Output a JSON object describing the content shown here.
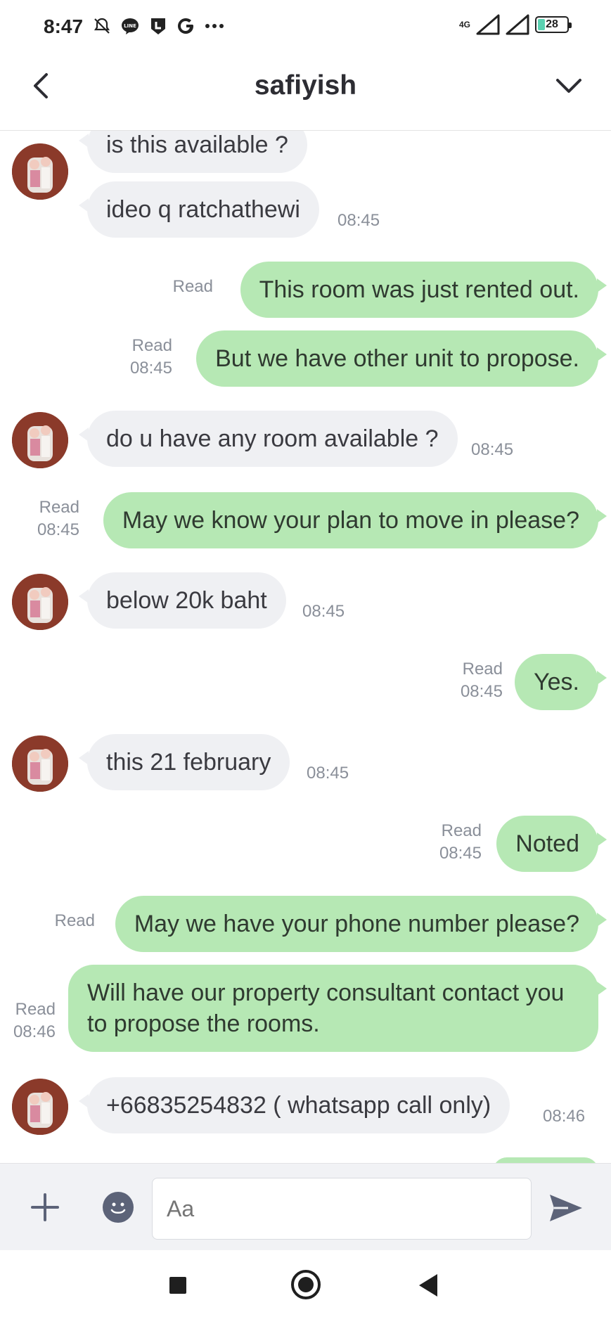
{
  "status_bar": {
    "time": "8:47",
    "icons": [
      "mute-icon",
      "line-icon",
      "l-icon",
      "g-icon",
      "more-dots-icon"
    ],
    "network": "4G",
    "battery": "28"
  },
  "header": {
    "title": "safiyish"
  },
  "messages": [
    {
      "side": "in",
      "text": "is this available ?",
      "time": ""
    },
    {
      "side": "in",
      "text": "ideo q ratchathewi",
      "time": "08:45"
    },
    {
      "side": "out",
      "text": "This room was just rented out.",
      "read": "Read",
      "time": ""
    },
    {
      "side": "out",
      "text": "But we have other unit to propose.",
      "read": "Read",
      "time": "08:45"
    },
    {
      "side": "in",
      "text": "do u have any room available ?",
      "time": "08:45"
    },
    {
      "side": "out",
      "text": "May we know your plan to move in please?",
      "read": "Read",
      "time": "08:45"
    },
    {
      "side": "in",
      "text": "below 20k baht",
      "time": "08:45"
    },
    {
      "side": "out",
      "text": "Yes.",
      "read": "Read",
      "time": "08:45"
    },
    {
      "side": "in",
      "text": "this 21 february",
      "time": "08:45"
    },
    {
      "side": "out",
      "text": "Noted",
      "read": "Read",
      "time": "08:45"
    },
    {
      "side": "out",
      "text": "May we have your phone number please?",
      "read": "Read",
      "time": ""
    },
    {
      "side": "out",
      "text": "Will have our property consultant contact you to propose the rooms.",
      "read": "Read",
      "time": "08:46"
    },
    {
      "side": "in",
      "text": "+66835254832 ( whatsapp call only)",
      "time": "08:46"
    }
  ],
  "input": {
    "placeholder": "Aa"
  },
  "colors": {
    "outgoing_bubble": "#b6e8b4",
    "incoming_bubble": "#eff0f3",
    "meta_text": "#8a8f99"
  }
}
